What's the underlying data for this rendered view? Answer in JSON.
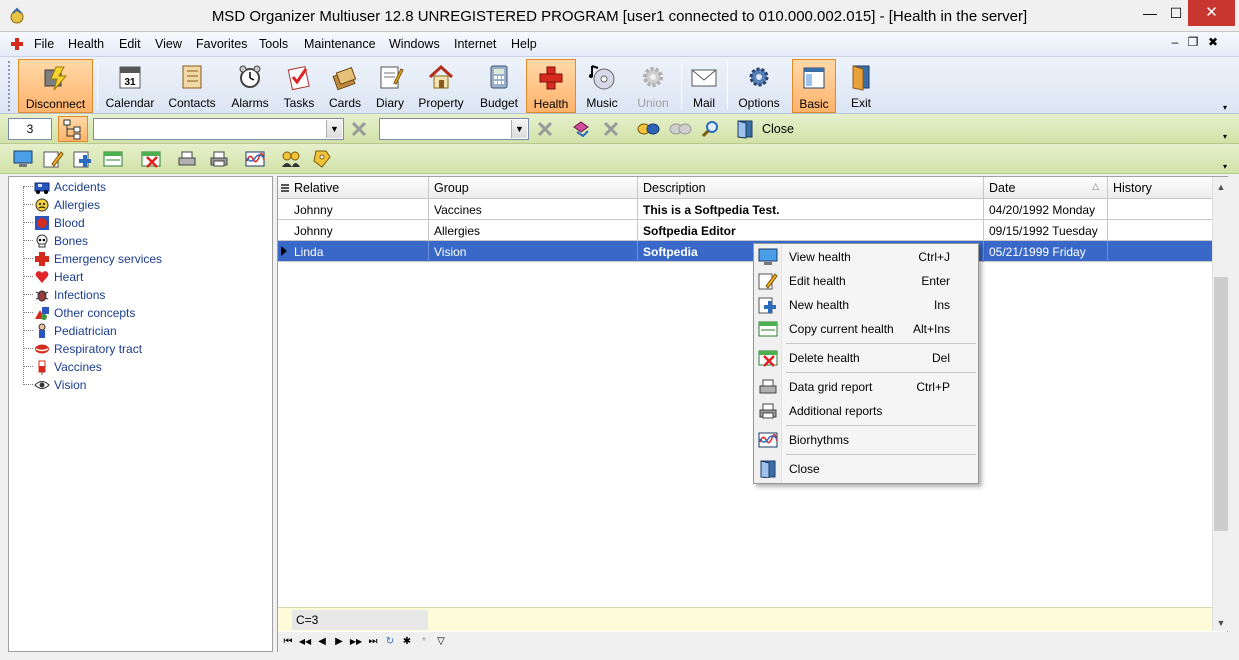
{
  "window": {
    "title": "MSD Organizer Multiuser 12.8 UNREGISTERED PROGRAM [user1 connected to 010.000.002.015] - [Health in the server]",
    "controls": {
      "minimize": "—",
      "maximize": "☐",
      "close": "✕"
    }
  },
  "menu": {
    "items": [
      "File",
      "Health",
      "Edit",
      "View",
      "Favorites",
      "Tools",
      "Maintenance",
      "Windows",
      "Internet",
      "Help"
    ],
    "mdi": {
      "minimize": "–",
      "restore": "❐",
      "close": "✖"
    }
  },
  "toolbar": {
    "buttons": [
      {
        "label": "Disconnect",
        "icon": "disconnect-icon"
      },
      {
        "label": "Calendar",
        "icon": "calendar-icon"
      },
      {
        "label": "Contacts",
        "icon": "contacts-icon"
      },
      {
        "label": "Alarms",
        "icon": "alarm-clock-icon"
      },
      {
        "label": "Tasks",
        "icon": "tasks-icon"
      },
      {
        "label": "Cards",
        "icon": "cards-icon"
      },
      {
        "label": "Diary",
        "icon": "diary-icon"
      },
      {
        "label": "Property",
        "icon": "house-icon"
      },
      {
        "label": "Budget",
        "icon": "calculator-icon"
      },
      {
        "label": "Health",
        "icon": "health-cross-icon"
      },
      {
        "label": "Music",
        "icon": "music-cd-icon"
      },
      {
        "label": "Union",
        "icon": "union-gear-icon"
      },
      {
        "label": "Mail",
        "icon": "mail-envelope-icon"
      },
      {
        "label": "Options",
        "icon": "options-gears-icon"
      },
      {
        "label": "Basic",
        "icon": "basic-window-icon"
      },
      {
        "label": "Exit",
        "icon": "exit-door-icon"
      }
    ]
  },
  "filterbar": {
    "count": "3",
    "close_label": "Close"
  },
  "tree": {
    "items": [
      {
        "label": "Accidents",
        "icon": "ambulance-icon"
      },
      {
        "label": "Allergies",
        "icon": "allergy-icon"
      },
      {
        "label": "Blood",
        "icon": "blood-icon"
      },
      {
        "label": "Bones",
        "icon": "skull-icon"
      },
      {
        "label": "Emergency services",
        "icon": "emergency-cross-icon"
      },
      {
        "label": "Heart",
        "icon": "heart-icon"
      },
      {
        "label": "Infections",
        "icon": "bug-icon"
      },
      {
        "label": "Other concepts",
        "icon": "shapes-icon"
      },
      {
        "label": "Pediatrician",
        "icon": "child-icon"
      },
      {
        "label": "Respiratory tract",
        "icon": "lips-icon"
      },
      {
        "label": "Vaccines",
        "icon": "syringe-icon"
      },
      {
        "label": "Vision",
        "icon": "eye-icon"
      }
    ]
  },
  "grid": {
    "columns": [
      "Relative",
      "Group",
      "Description",
      "Date",
      "History"
    ],
    "sort_indicator": "△",
    "rows": [
      {
        "relative": "Johnny",
        "group": "Vaccines",
        "description": "This is a Softpedia Test.",
        "date": "04/20/1992 Monday",
        "history": ""
      },
      {
        "relative": "Johnny",
        "group": "Allergies",
        "description": "Softpedia Editor",
        "date": "09/15/1992 Tuesday",
        "history": ""
      },
      {
        "relative": "Linda",
        "group": "Vision",
        "description": "Softpedia",
        "date": "05/21/1999 Friday",
        "history": ""
      }
    ],
    "footer": "C=3",
    "nav": [
      "⏮",
      "◀◀",
      "◀",
      "▶",
      "▶▶",
      "⏭",
      "↻",
      "✱",
      "*",
      "▽"
    ]
  },
  "context_menu": {
    "items": [
      {
        "label": "View health",
        "shortcut": "Ctrl+J",
        "icon": "monitor-icon"
      },
      {
        "label": "Edit health",
        "shortcut": "Enter",
        "icon": "edit-pencil-icon"
      },
      {
        "label": "New health",
        "shortcut": "Ins",
        "icon": "new-plus-icon"
      },
      {
        "label": "Copy current health",
        "shortcut": "Alt+Ins",
        "icon": "copy-record-icon"
      },
      {
        "label": "Delete health",
        "shortcut": "Del",
        "icon": "delete-x-icon"
      },
      {
        "label": "Data grid report",
        "shortcut": "Ctrl+P",
        "icon": "printer-icon"
      },
      {
        "label": "Additional reports",
        "shortcut": "",
        "icon": "printer-reports-icon"
      },
      {
        "label": "Biorhythms",
        "shortcut": "",
        "icon": "biorhythm-chart-icon"
      },
      {
        "label": "Close",
        "shortcut": "",
        "icon": "close-door-icon"
      }
    ]
  },
  "colors": {
    "selection": "#3968c9",
    "toolbar_active": "#ffb36b",
    "filterbar": "#d2e2a8",
    "close_button": "#c7372f",
    "footer_row": "#fdfbd8"
  }
}
